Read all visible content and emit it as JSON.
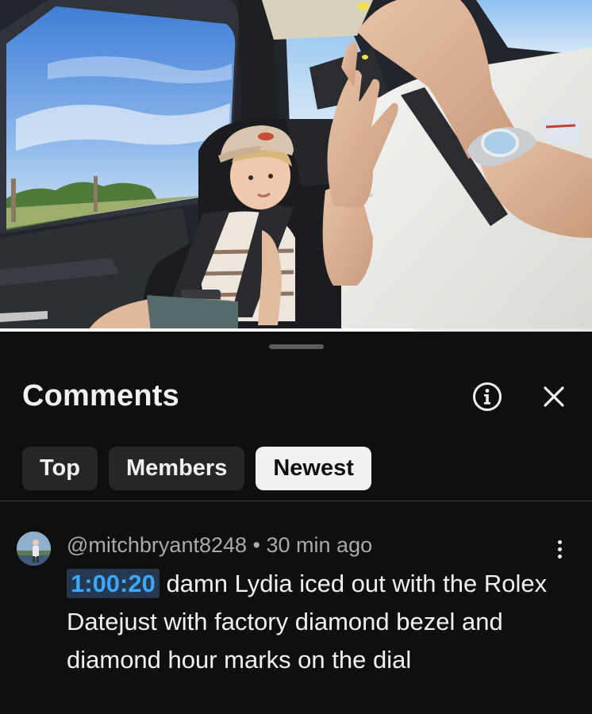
{
  "video": {
    "progress_fraction": 0.7,
    "scene": "car-interior-child-in-car-seat"
  },
  "comments_panel": {
    "title": "Comments",
    "info_icon": "info-circle-icon",
    "close_icon": "close-icon",
    "sort_chips": [
      {
        "label": "Top",
        "selected": false
      },
      {
        "label": "Members",
        "selected": false
      },
      {
        "label": "Newest",
        "selected": true
      }
    ]
  },
  "comments": [
    {
      "author": "@mitchbryant8248",
      "separator": "•",
      "age": "30 min ago",
      "timestamp_link": "1:00:20",
      "text": " damn Lydia iced out with the Rolex Datejust with factory diamond bezel and diamond hour marks on the dial",
      "menu_icon": "more-vert-icon"
    }
  ],
  "colors": {
    "background": "#0f0f0f",
    "chip": "#272727",
    "chip_selected": "#f1f1f1",
    "timestamp_text": "#3ea6ff",
    "timestamp_bg": "#263850",
    "meta_text": "#aaaaaa"
  }
}
